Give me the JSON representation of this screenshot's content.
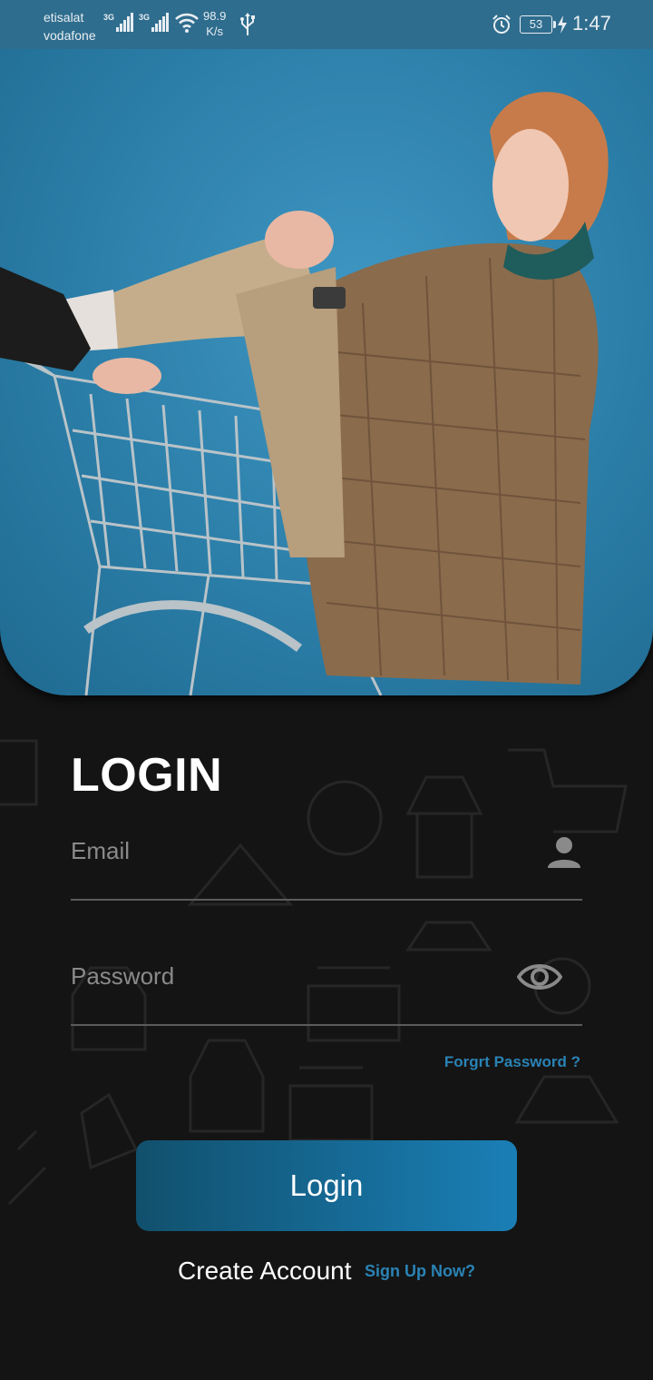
{
  "status_bar": {
    "carrier_1": "etisalat",
    "carrier_2": "vodafone",
    "net_tag_1": "3G",
    "net_tag_2": "3G",
    "speed_value": "98.9",
    "speed_unit": "K/s",
    "battery": "53",
    "time": "1:47",
    "icons": [
      "signal-icon",
      "wifi-icon",
      "usb-icon",
      "alarm-icon",
      "battery-icon",
      "charging-icon"
    ]
  },
  "hero": {
    "image": "hero-photo",
    "background_color": "#2f86b3"
  },
  "form": {
    "title": "LOGIN",
    "email": {
      "placeholder": "Email",
      "value": "",
      "icon": "person-icon"
    },
    "password": {
      "placeholder": "Password",
      "value": "",
      "icon": "eye-icon"
    },
    "forgot_link": "Forgrt Password ?",
    "login_button": "Login",
    "create_account_label": "Create Account",
    "signup_link": "Sign Up Now?"
  },
  "colors": {
    "background": "#141414",
    "accent": "#2a83b5",
    "button_start": "#11506d",
    "button_end": "#1a7fb6"
  }
}
